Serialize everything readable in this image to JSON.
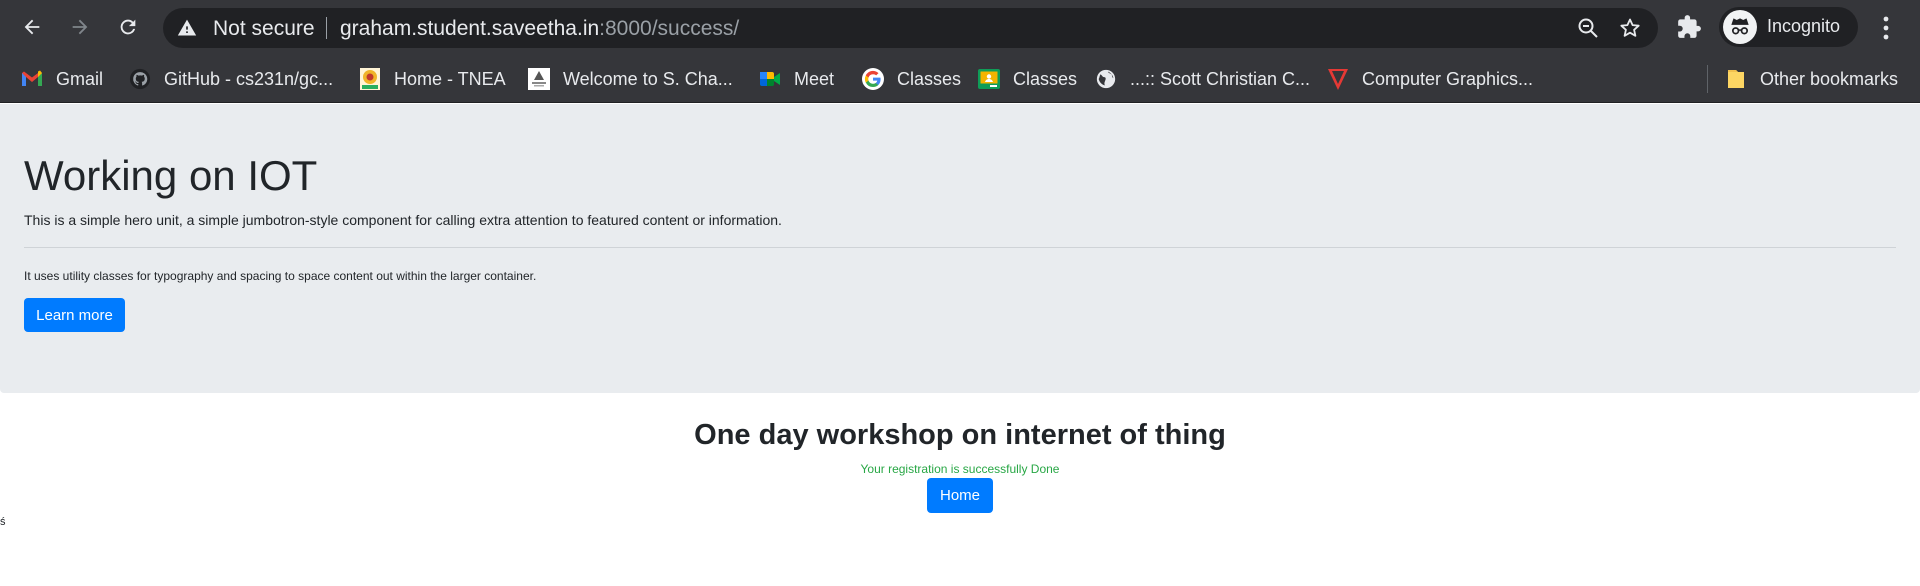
{
  "browser": {
    "omnibox": {
      "security_label": "Not secure",
      "url_host": "graham.student.saveetha.in",
      "url_rest": ":8000/success/"
    },
    "profile_label": "Incognito",
    "bookmarks": [
      {
        "label": "Gmail",
        "icon": "gmail-icon"
      },
      {
        "label": "GitHub - cs231n/gc...",
        "icon": "github-icon"
      },
      {
        "label": "Home - TNEA",
        "icon": "tnea-icon"
      },
      {
        "label": "Welcome to S. Cha...",
        "icon": "site-icon"
      },
      {
        "label": "Meet",
        "icon": "meet-icon"
      },
      {
        "label": "Classes",
        "icon": "google-icon"
      },
      {
        "label": "Classes",
        "icon": "classroom-icon"
      },
      {
        "label": "...:: Scott Christian C...",
        "icon": "globe-icon"
      },
      {
        "label": "Computer Graphics...",
        "icon": "red-v-icon"
      }
    ],
    "other_bookmarks": "Other bookmarks"
  },
  "page": {
    "hero": {
      "title": "Working on IOT",
      "lead": "This is a simple hero unit, a simple jumbotron-style component for calling extra attention to featured content or information.",
      "text": "It uses utility classes for typography and spacing to space content out within the larger container.",
      "button": "Learn more"
    },
    "workshop_title": "One day workshop on internet of thing",
    "success_message": "Your registration is successfully Done",
    "home_button": "Home",
    "stray_char": "ś"
  },
  "colors": {
    "primary": "#007bff",
    "success": "#28a745",
    "jumbotron_bg": "#e9ecef",
    "toolbar_bg": "#35363a"
  }
}
